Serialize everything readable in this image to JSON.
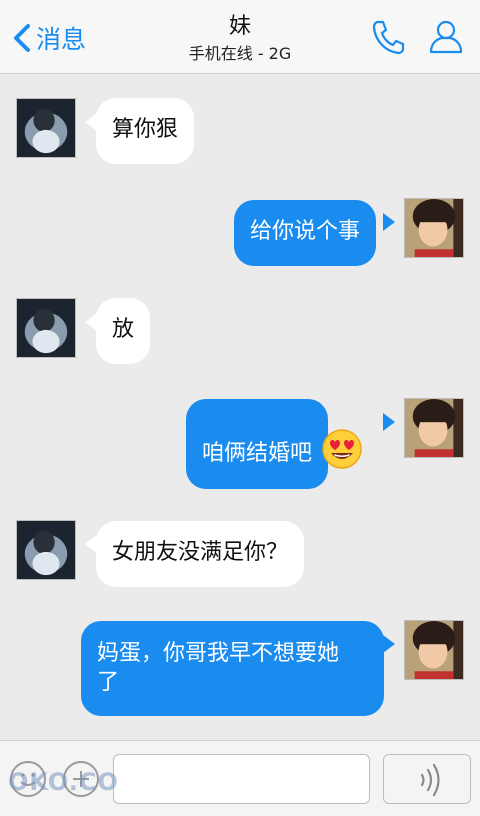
{
  "header": {
    "back_label": "消息",
    "title": "妹",
    "subtitle": "手机在线 - 2G"
  },
  "messages": [
    {
      "direction": "in",
      "text": "算你狠"
    },
    {
      "direction": "out",
      "text": "给你说个事"
    },
    {
      "direction": "in",
      "text": "放"
    },
    {
      "direction": "out",
      "text": "咱俩结婚吧",
      "emoji": "smiling-heart-eyes-emoji"
    },
    {
      "direction": "in",
      "text": "女朋友没满足你？"
    },
    {
      "direction": "out",
      "text": "妈蛋，你哥我早不想要她",
      "text_line2": "了"
    }
  ],
  "input": {
    "value": "",
    "placeholder": ""
  },
  "watermark": "OKO.CO",
  "colors": {
    "accent": "#1a8cf0",
    "background": "#ebebeb",
    "incoming_bubble": "#ffffff"
  },
  "icons": [
    "back-chevron-icon",
    "phone-icon",
    "contact-icon",
    "emoji-icon",
    "plus-icon",
    "voice-icon"
  ]
}
